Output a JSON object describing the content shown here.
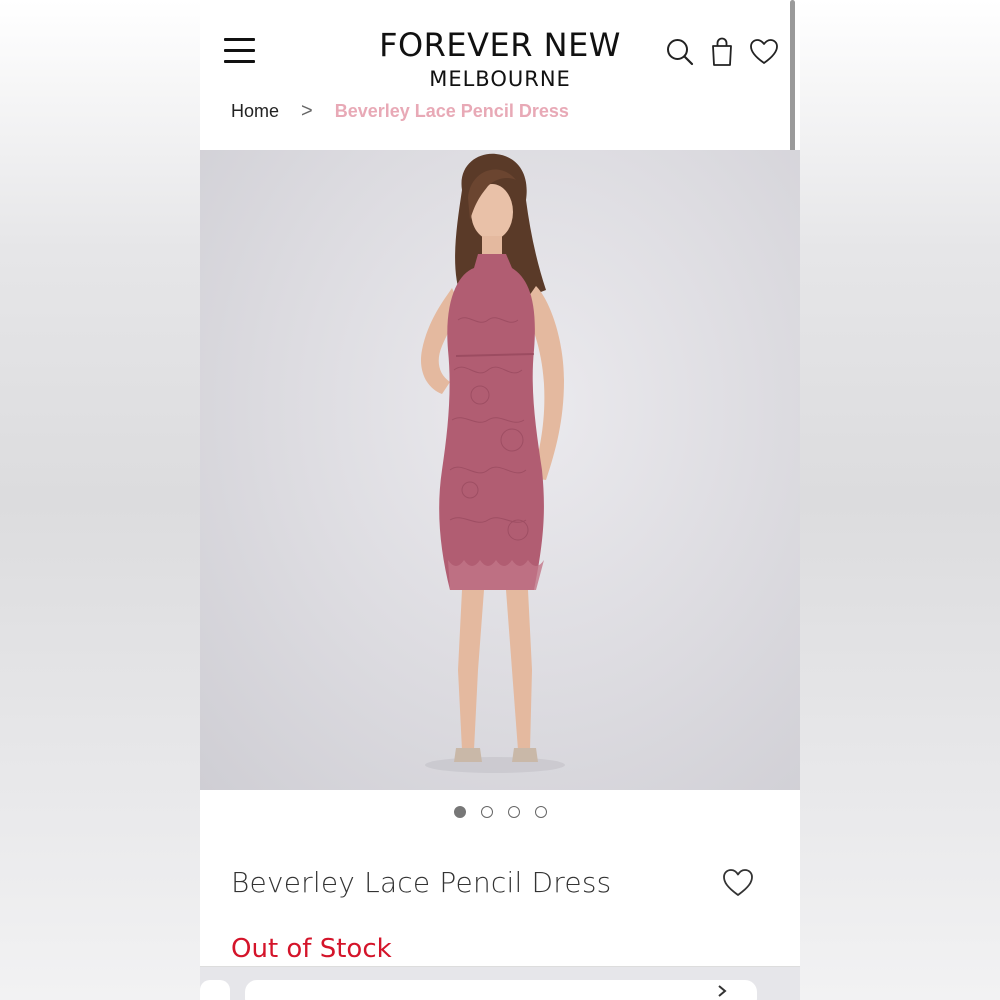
{
  "header": {
    "brand_main": "FOREVER NEW",
    "brand_sub": "MELBOURNE",
    "icons": [
      "menu-icon",
      "search-icon",
      "bag-icon",
      "heart-icon"
    ]
  },
  "breadcrumb": {
    "home": "Home",
    "separator": ">",
    "current": "Beverley Lace Pencil Dress"
  },
  "gallery": {
    "image_count": 4,
    "active_index": 0
  },
  "product": {
    "title": "Beverley Lace Pencil Dress",
    "stock_status": "Out of Stock"
  },
  "colors": {
    "accent_breadcrumb": "#e8a9b6",
    "stock_red": "#d4142a",
    "dress_rose": "#b15d72"
  }
}
